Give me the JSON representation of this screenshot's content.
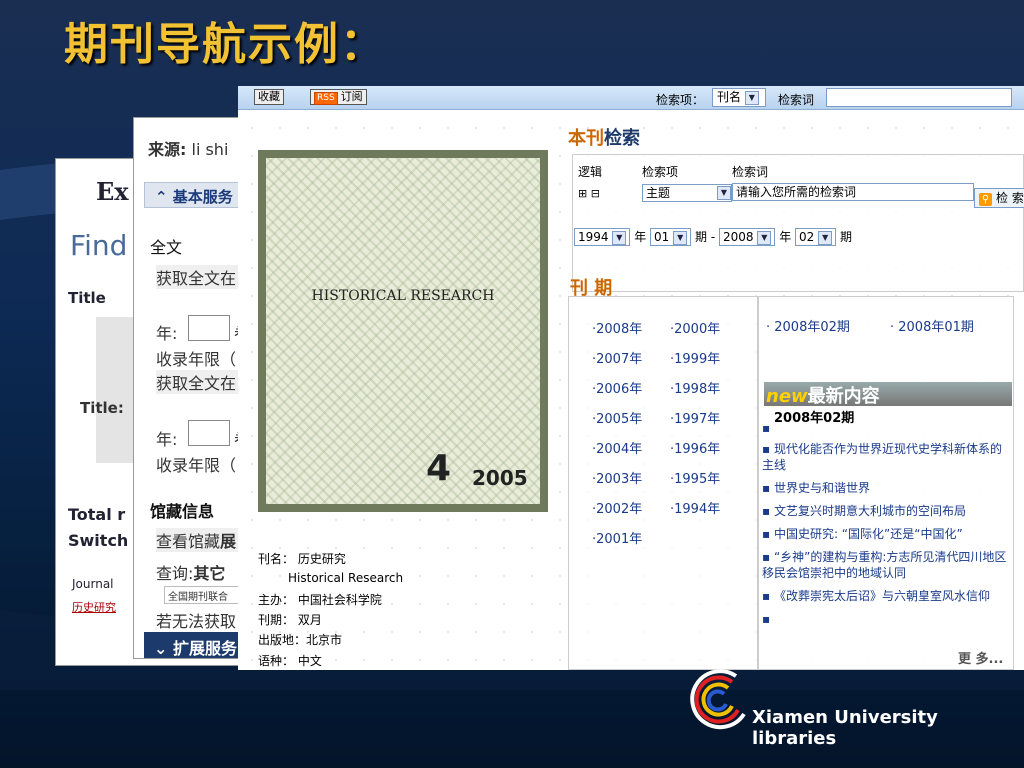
{
  "slide_title": "期刊导航示例：",
  "back_window": {
    "ex": "Ex",
    "find": "Find",
    "title": "Title",
    "title2": "Title:",
    "total": "Total r",
    "switch": "Switch",
    "journal": "Journal",
    "link": "历史研究"
  },
  "mid_window": {
    "source_label": "来源:",
    "source_value": " li shi",
    "basic_service": "⌃ 基本服务",
    "fulltext": "全文",
    "get_fulltext": "获取全文在",
    "year_label": "年:",
    "year_sfx": "卷",
    "coverage": "收录年限（",
    "get_fulltext2": "获取全文在",
    "year_label2": "年:",
    "year_sfx2": "卷",
    "coverage2": "收录年限（",
    "holdings": "馆藏信息",
    "view_holdings": "查看馆藏",
    "view_holdings_b": "展",
    "query": "查询:",
    "query_b": "其它",
    "union": "全国期刊联合",
    "cannot": "若无法获取",
    "extended": "⌄ 扩展服务"
  },
  "front_window": {
    "topbar": {
      "collect": "收藏",
      "rss": "RSS",
      "subscribe": "订阅",
      "search_item_label": "检索项：",
      "search_item_value": "刊名",
      "search_word_label": "检索词"
    },
    "cover": {
      "title_cn": "",
      "title_en": "HISTORICAL RESEARCH",
      "issue": "4",
      "year": "2005"
    },
    "meta": {
      "name_label": "刊名：",
      "name": "历史研究",
      "name_en": "Historical Research",
      "sponsor_label": "主办：",
      "sponsor": "中国社会科学院",
      "freq_label": "刊期：",
      "freq": "双月",
      "place_label": "出版地：",
      "place": "北京市",
      "lang_label": "语种：",
      "lang": "中文"
    },
    "search": {
      "title_a": "本刊",
      "title_b": "检索",
      "col_logic": "逻辑",
      "col_item": "检索项",
      "col_word": "检索词",
      "item_value": "主题",
      "placeholder": "请输入您所需的检索词",
      "btn": "检 索",
      "from_year": "1994",
      "from_issue": "01",
      "to_year": "2008",
      "to_issue": "02",
      "year": "年",
      "issue": "期",
      "dash": "-"
    },
    "issues": {
      "title": "刊 期",
      "years_left": [
        "·2008年",
        "·2007年",
        "·2006年",
        "·2005年",
        "·2004年",
        "·2003年",
        "·2002年",
        "·2001年"
      ],
      "years_right": [
        "·2000年",
        "·1999年",
        "·1998年",
        "·1997年",
        "·1996年",
        "·1995年",
        "·1994年"
      ],
      "latest_issues": [
        "· 2008年02期",
        "· 2008年01期"
      ]
    },
    "news": {
      "header_new": "new",
      "header_text": "最新内容",
      "issue": "2008年02期",
      "items": [
        "",
        "现代化能否作为世界近现代史学科新体系的主线",
        "世界史与和谐世界",
        "文艺复兴时期意大利城市的空间布局",
        "中国史研究: “国际化”还是“中国化”",
        "“乡神”的建构与重构:方志所见清代四川地区移民会馆崇祀中的地域认同",
        "《改葬崇宪太后诏》与六朝皇室风水信仰",
        ""
      ],
      "more": "更 多..."
    }
  },
  "footer_logo": "Xiamen University libraries"
}
